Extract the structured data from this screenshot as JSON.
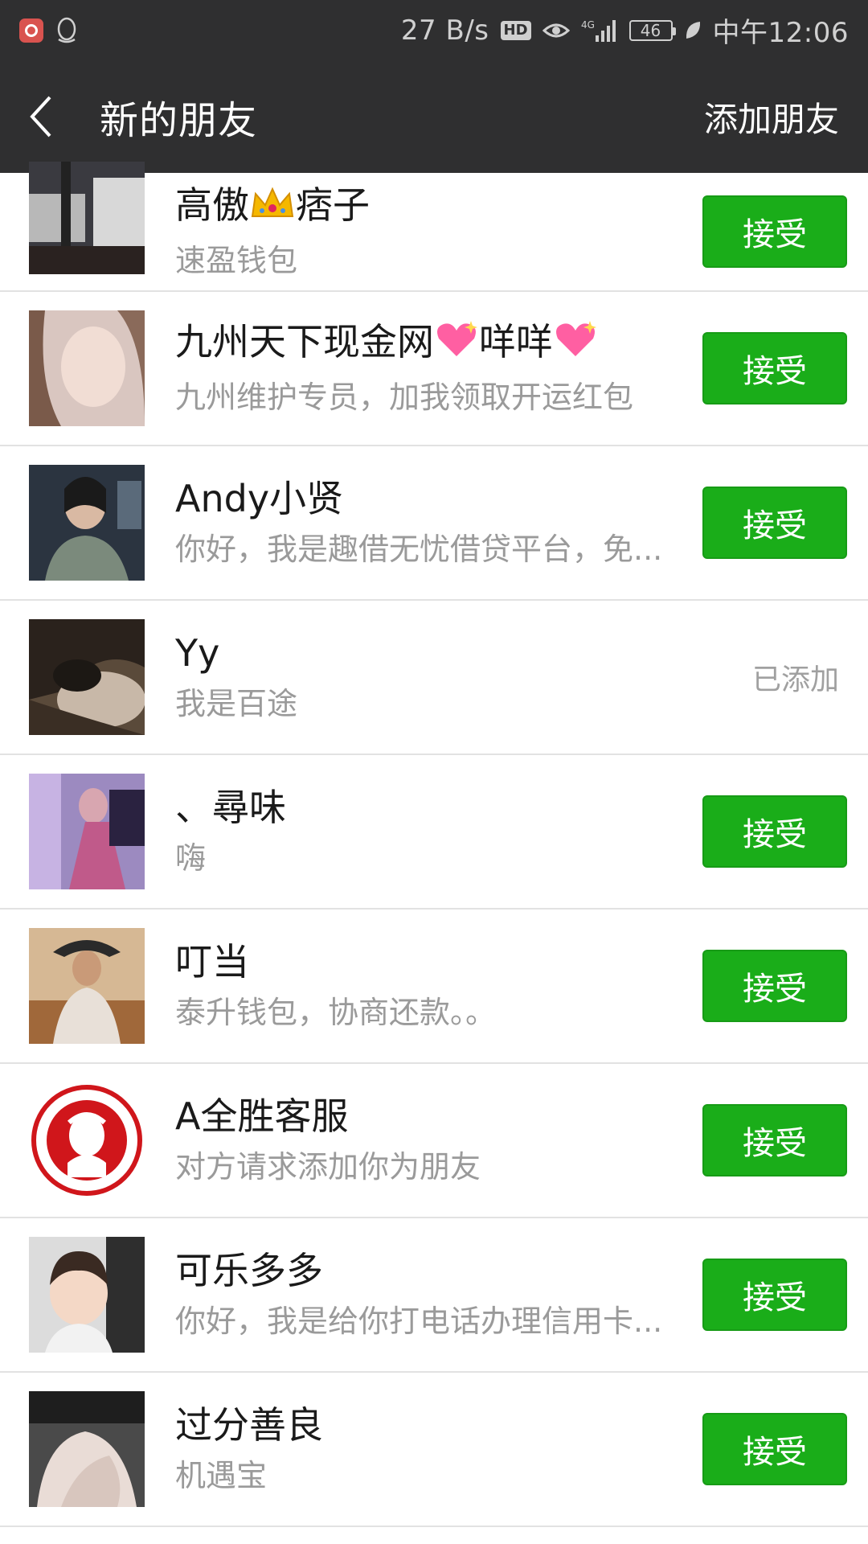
{
  "status_bar": {
    "speed": "27 B/s",
    "hd": "HD",
    "network": "4G",
    "battery": "46",
    "time": "中午12:06"
  },
  "nav": {
    "title": "新的朋友",
    "action": "添加朋友"
  },
  "requests": [
    {
      "name_a": "高傲",
      "name_b": "痞子",
      "message": "速盈钱包",
      "status": "接受"
    },
    {
      "name_a": "九州天下现金网",
      "name_b": "咩咩",
      "message": "九州维护专员，加我领取开运红包",
      "status": "接受"
    },
    {
      "name": "Andy小贤",
      "message": "你好，我是趣借无忧借贷平台，免...",
      "status": "接受"
    },
    {
      "name": "Yy",
      "message": "我是百途",
      "status": "已添加"
    },
    {
      "name": "、尋味",
      "message": "嗨",
      "status": "接受"
    },
    {
      "name": "叮当",
      "message": "泰升钱包，协商还款。。",
      "status": "接受"
    },
    {
      "name": "A全胜客服",
      "message": "对方请求添加你为朋友",
      "status": "接受"
    },
    {
      "name": "可乐多多",
      "message": "你好，我是给你打电话办理信用卡...",
      "status": "接受"
    },
    {
      "name": "过分善良",
      "message": "机遇宝",
      "status": "接受"
    }
  ],
  "icons": {
    "crown": "crown-icon",
    "heart": "sparkling-heart-icon"
  },
  "colors": {
    "bar": "#2f2f30",
    "accept": "#1aad19"
  }
}
